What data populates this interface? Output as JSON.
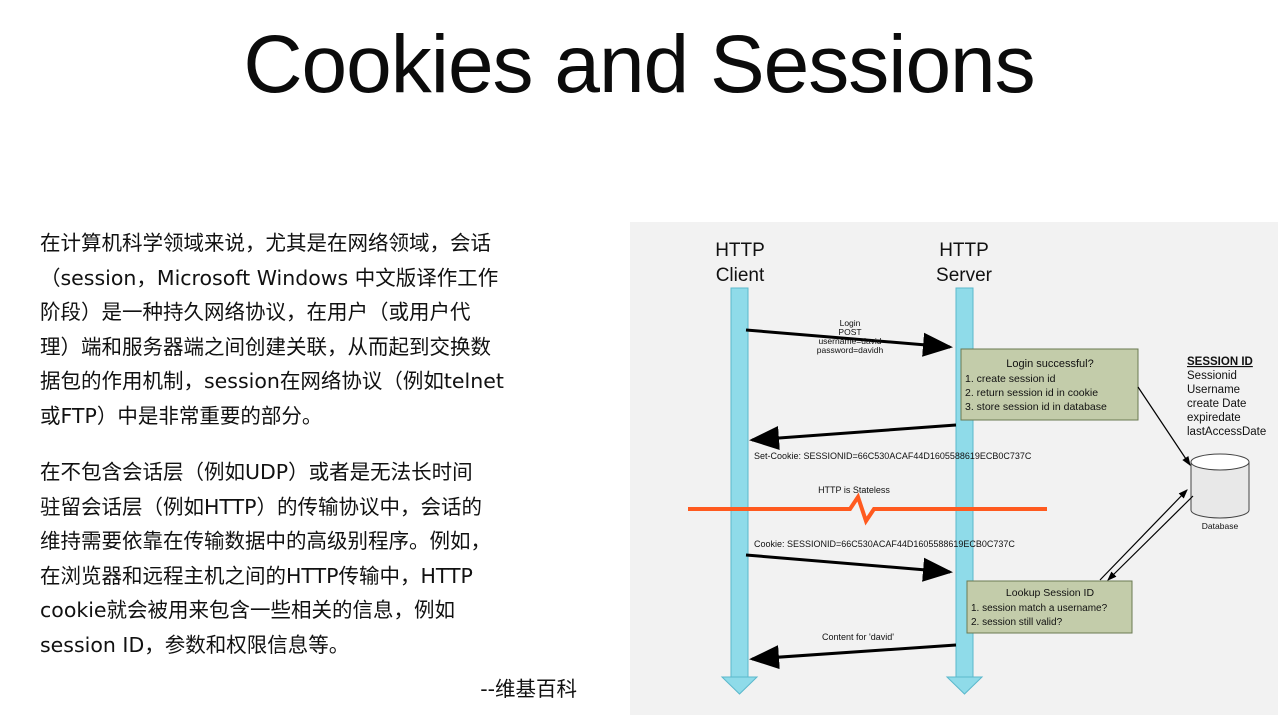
{
  "slide": {
    "title": "Cookies and Sessions",
    "paragraphs": [
      [
        "在计算机科学领域来说，尤其是在网络领域，会话",
        "（session，Microsoft Windows 中文版译作工作",
        "阶段）是一种持久网络协议，在用户（或用户代",
        "理）端和服务器端之间创建关联，从而起到交换数",
        "据包的作用机制，session在网络协议（例如telnet",
        "或FTP）中是非常重要的部分。"
      ],
      [
        "在不包含会话层（例如UDP）或者是无法长时间",
        "驻留会话层（例如HTTP）的传输协议中，会话的",
        "维持需要依靠在传输数据中的高级别程序。例如，",
        "在浏览器和远程主机之间的HTTP传输中，HTTP",
        "cookie就会被用来包含一些相关的信息，例如",
        "session ID，参数和权限信息等。"
      ]
    ],
    "attribution": "--维基百科"
  },
  "diagram": {
    "client_label_1": "HTTP",
    "client_label_2": "Client",
    "server_label_1": "HTTP",
    "server_label_2": "Server",
    "login_request": [
      "Login",
      "POST",
      "username=david",
      "password=davidh"
    ],
    "login_box": {
      "title": "Login successful?",
      "items": [
        "1.  create session id",
        "2.  return session id in cookie",
        "3.  store session id in database"
      ]
    },
    "set_cookie": "Set-Cookie: SESSIONID=66C530ACAF44D1605588619ECB0C737C",
    "stateless": "HTTP is Stateless",
    "cookie": "Cookie: SESSIONID=66C530ACAF44D1605588619ECB0C737C",
    "lookup_box": {
      "title": "Lookup Session ID",
      "items": [
        "1.  session match a username?",
        "2.  session still valid?"
      ]
    },
    "content": "Content for 'david'",
    "session_panel": {
      "heading": "SESSION ID",
      "fields": [
        "Sessionid",
        "Username",
        "create Date",
        "expiredate",
        "lastAccessDate"
      ]
    },
    "database_label": "Database",
    "colors": {
      "lifeline": "#8fdbe9",
      "lifeline_edge": "#5bb8cc",
      "box_fill": "#c3ccaa",
      "box_edge": "#6b7a52",
      "stateless_line": "#ff5a1f",
      "background": "#f2f2f2"
    }
  }
}
